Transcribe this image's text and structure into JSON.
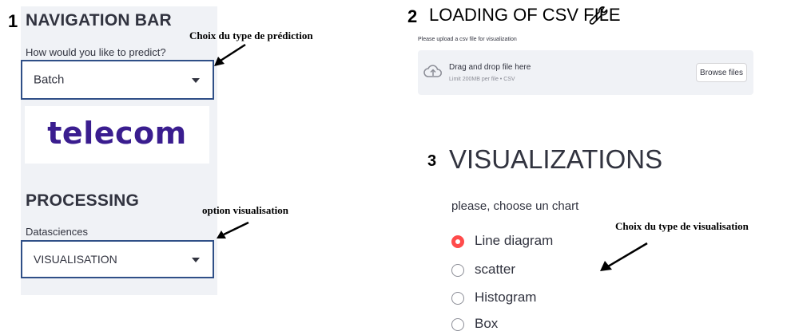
{
  "sidebar": {
    "section1_number": "1",
    "section1_title": "NAVIGATION BAR",
    "predict_label": "How would you like to predict?",
    "predict_value": "Batch",
    "logo_text": "telecom",
    "section2_title": "PROCESSING",
    "datasciences_label": "Datasciences",
    "datasciences_value": "VISUALISATION"
  },
  "upload": {
    "section_number": "2",
    "title": "LOADING OF CSV FILE",
    "instruction": "Please upload a csv file for visualization",
    "drop_text": "Drag and drop file here",
    "limit_text": "Limit 200MB per file • CSV",
    "browse_label": "Browse files"
  },
  "visualizations": {
    "section_number": "3",
    "title": "VISUALIZATIONS",
    "prompt": "please, choose un chart",
    "options": [
      {
        "label": "Line diagram",
        "selected": true
      },
      {
        "label": "scatter",
        "selected": false
      },
      {
        "label": "Histogram",
        "selected": false
      },
      {
        "label": "Box",
        "selected": false
      }
    ]
  },
  "annotations": {
    "prediction_type": "Choix du type de prédiction",
    "visualisation_option": "option visualisation",
    "visualisation_type": "Choix du type de  visualisation"
  },
  "colors": {
    "sidebar_bg": "#f0f2f6",
    "select_border": "#2f4f87",
    "logo": "#3a1d8f",
    "radio_selected": "#ff4b4b"
  }
}
